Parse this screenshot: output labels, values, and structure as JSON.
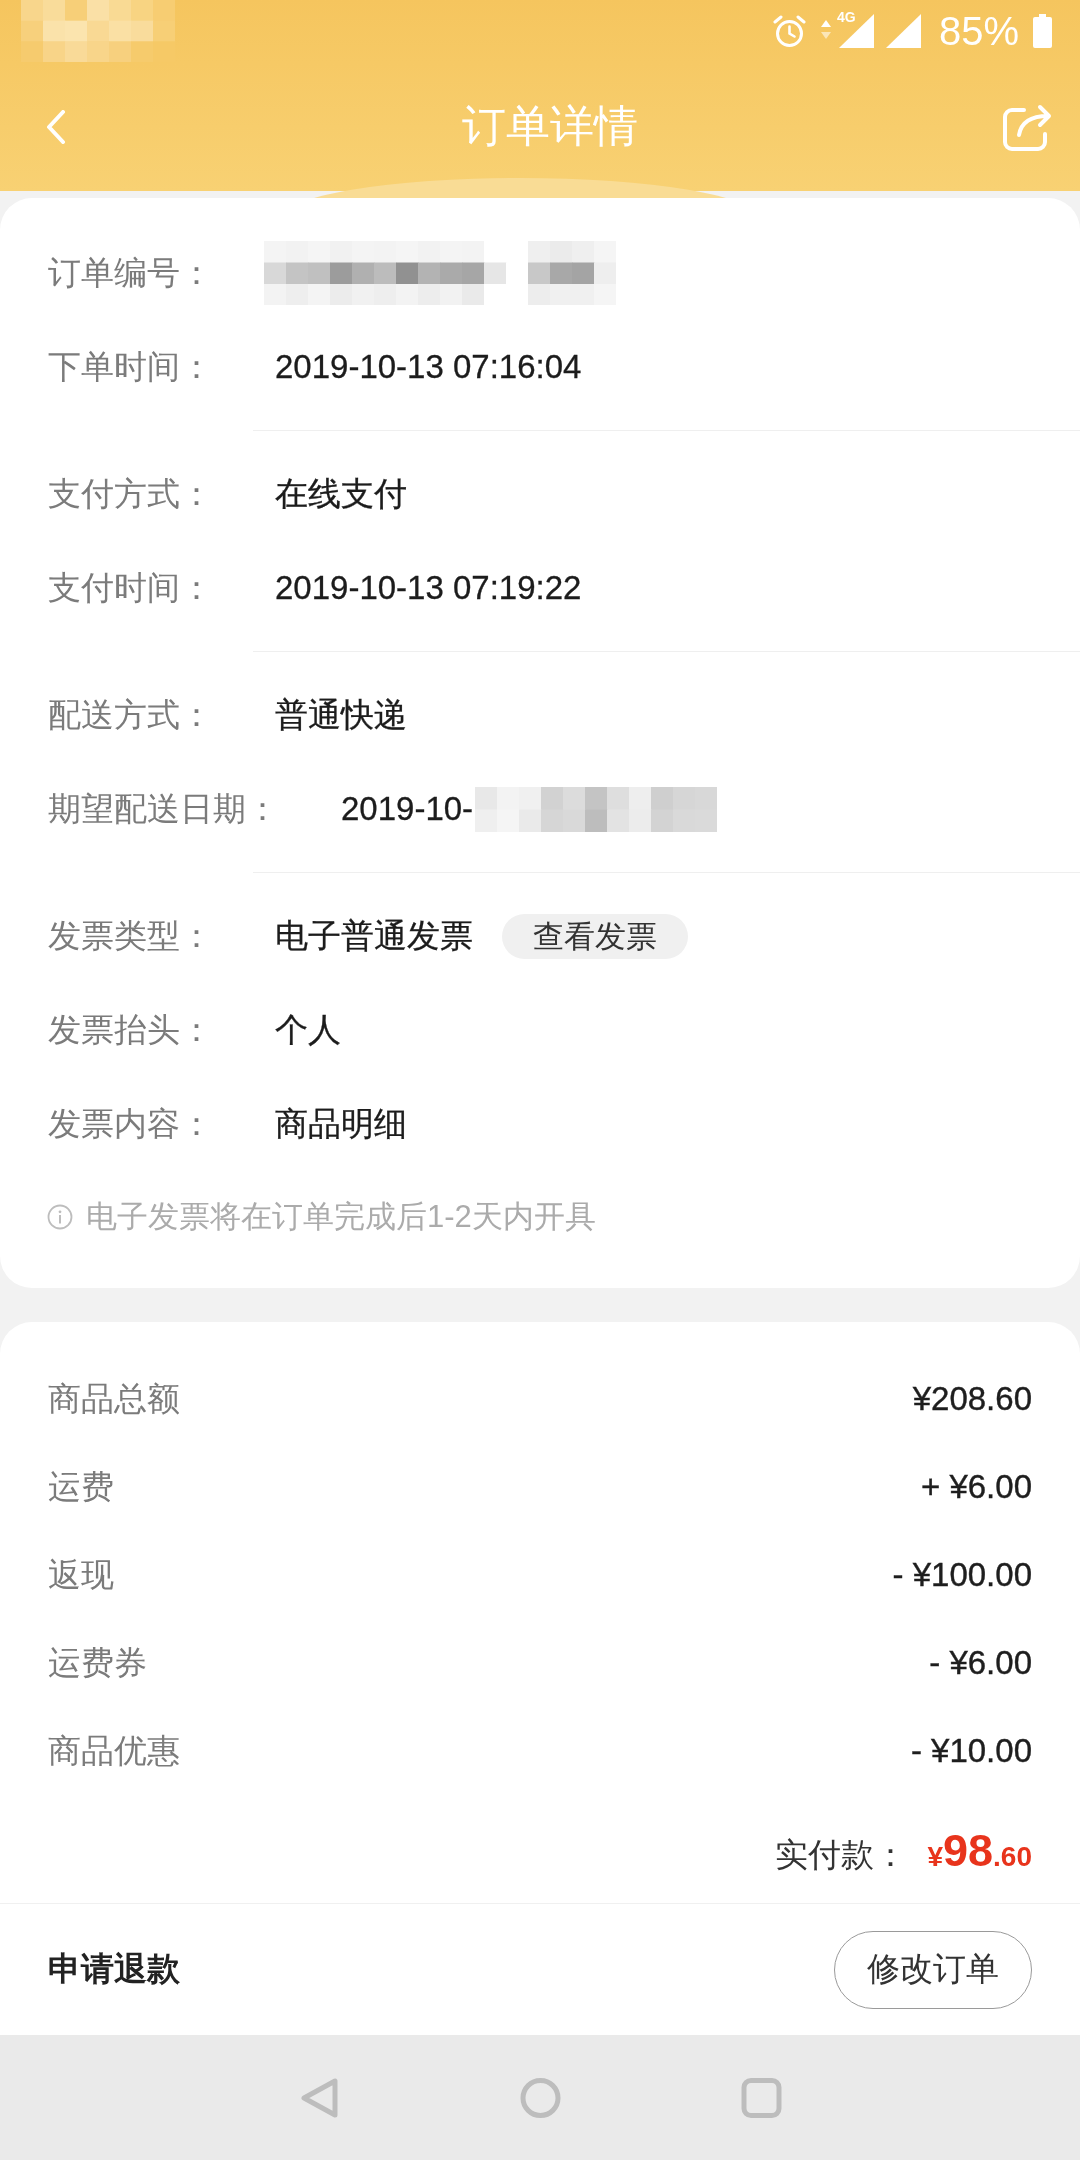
{
  "status_bar": {
    "network": "4G",
    "battery": "85%"
  },
  "header": {
    "title": "订单详情"
  },
  "order_info": {
    "groups": [
      {
        "rows": [
          {
            "label": "订单编号：",
            "masked": true
          },
          {
            "label": "下单时间：",
            "value": "2019-10-13 07:16:04",
            "masked": false
          }
        ]
      },
      {
        "rows": [
          {
            "label": "支付方式：",
            "value": "在线支付",
            "masked": false
          },
          {
            "label": "支付时间：",
            "value": "2019-10-13 07:19:22",
            "masked": false
          }
        ]
      },
      {
        "rows": [
          {
            "label": "配送方式：",
            "value": "普通快递",
            "masked": false
          },
          {
            "label": "期望配送日期：",
            "value": "2019-10-",
            "masked": true
          }
        ]
      },
      {
        "rows": [
          {
            "label": "发票类型：",
            "value": "电子普通发票",
            "button": "查看发票",
            "masked": false
          },
          {
            "label": "发票抬头：",
            "value": "个人",
            "masked": false
          },
          {
            "label": "发票内容：",
            "value": "商品明细",
            "masked": false
          }
        ]
      }
    ],
    "note": "电子发票将在订单完成后1-2天内开具"
  },
  "price_summary": {
    "rows": [
      {
        "label": "商品总额",
        "value": "¥208.60"
      },
      {
        "label": "运费",
        "value": "+ ¥6.00"
      },
      {
        "label": "返现",
        "value": "- ¥100.00"
      },
      {
        "label": "运费券",
        "value": "- ¥6.00"
      },
      {
        "label": "商品优惠",
        "value": "- ¥10.00"
      }
    ],
    "total": {
      "label": "实付款：",
      "currency": "¥",
      "integer": "98",
      "decimal": ".60"
    }
  },
  "footer": {
    "refund_link": "申请退款",
    "modify_button": "修改订单"
  }
}
